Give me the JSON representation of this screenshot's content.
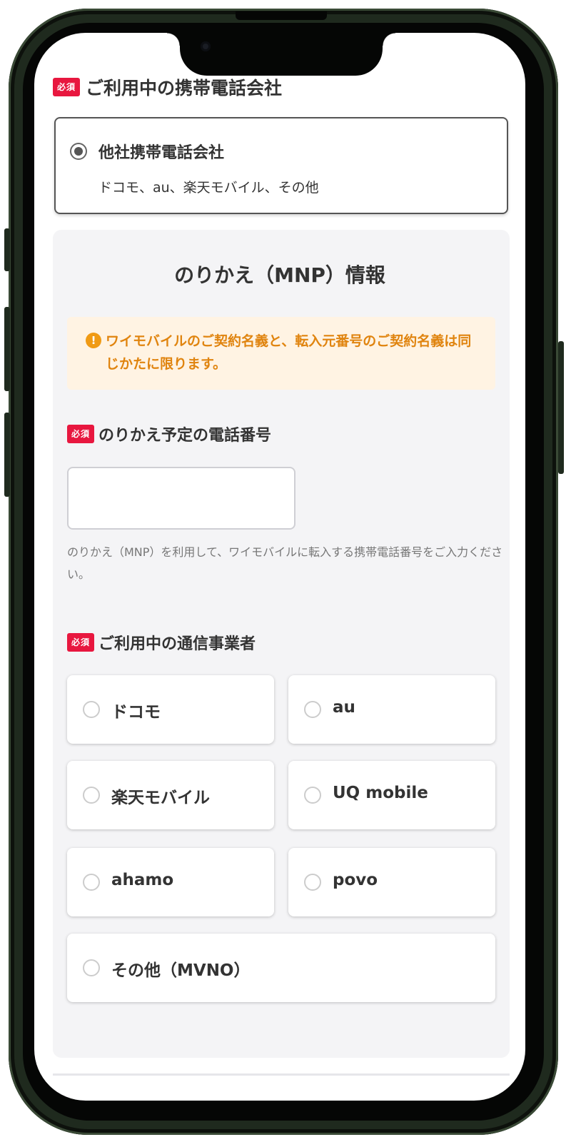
{
  "current_carrier_section": {
    "required_badge": "必須",
    "heading": "ご利用中の携帯電話会社",
    "selected_option": {
      "title": "他社携帯電話会社",
      "subtitle": "ドコモ、au、楽天モバイル、その他"
    }
  },
  "mnp_section": {
    "title": "のりかえ（MNP）情報",
    "notice": "ワイモバイルのご契約名義と、転入元番号のご契約名義は同じかたに限ります。",
    "phone_number": {
      "required_badge": "必須",
      "label": "のりかえ予定の電話番号",
      "value": "",
      "help": "のりかえ（MNP）を利用して、ワイモバイルに転入する携帯電話番号をご入力ください。"
    },
    "carrier": {
      "required_badge": "必須",
      "label": "ご利用中の通信事業者",
      "options": [
        "ドコモ",
        "au",
        "楽天モバイル",
        "UQ mobile",
        "ahamo",
        "povo",
        "その他（MVNO）"
      ]
    }
  },
  "colors": {
    "required_badge": "#e8173f",
    "notice_text": "#e0840f",
    "notice_background": "#fff3e3",
    "panel_background": "#f4f4f6"
  }
}
